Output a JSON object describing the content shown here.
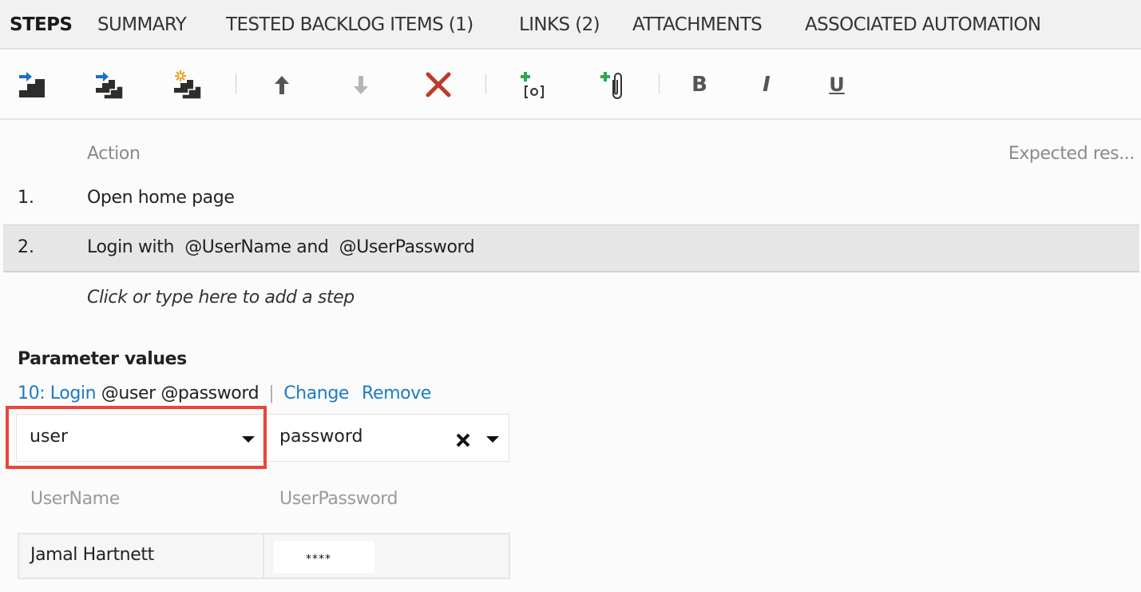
{
  "tabs": [
    {
      "label": "STEPS",
      "active": true
    },
    {
      "label": "SUMMARY",
      "active": false
    },
    {
      "label": "TESTED BACKLOG ITEMS (1)",
      "active": false
    },
    {
      "label": "LINKS (2)",
      "active": false
    },
    {
      "label": "ATTACHMENTS",
      "active": false
    },
    {
      "label": "ASSOCIATED AUTOMATION",
      "active": false
    }
  ],
  "toolbar": {
    "insert_step": "insert-step-icon",
    "insert_shared_steps": "insert-shared-steps-icon",
    "create_shared_steps": "create-shared-steps-icon",
    "move_up": "arrow-up-icon",
    "move_down": "arrow-down-icon",
    "delete": "delete-x-icon",
    "insert_parameter": "insert-parameter-icon",
    "add_attachment": "add-attachment-icon",
    "bold_label": "B",
    "italic_label": "I",
    "underline_label": "U"
  },
  "steps_table": {
    "action_header": "Action",
    "expected_header": "Expected res...",
    "steps": [
      {
        "number": "1.",
        "action": "Open home page",
        "selected": false
      },
      {
        "number": "2.",
        "action": "Login with  @UserName and  @UserPassword",
        "selected": true
      }
    ],
    "add_step_placeholder": "Click or type here to add a step"
  },
  "parameters": {
    "title": "Parameter values",
    "shared_param_link": "10: Login",
    "shared_param_names": " @user @password",
    "separator": "|",
    "change_label": "Change",
    "remove_label": "Remove",
    "mapping": [
      {
        "value": "user",
        "clearable": false
      },
      {
        "value": "password",
        "clearable": true
      }
    ],
    "columns": [
      "UserName",
      "UserPassword"
    ],
    "rows": [
      [
        "Jamal Hartnett",
        "****"
      ]
    ]
  },
  "colors": {
    "link": "#1b7bc6",
    "highlight_border": "#e8473a",
    "delete_icon": "#c0392b",
    "add_plus": "#2fa84f",
    "insert_arrow": "#1b6fd1",
    "sparkle": "#e8a020"
  }
}
